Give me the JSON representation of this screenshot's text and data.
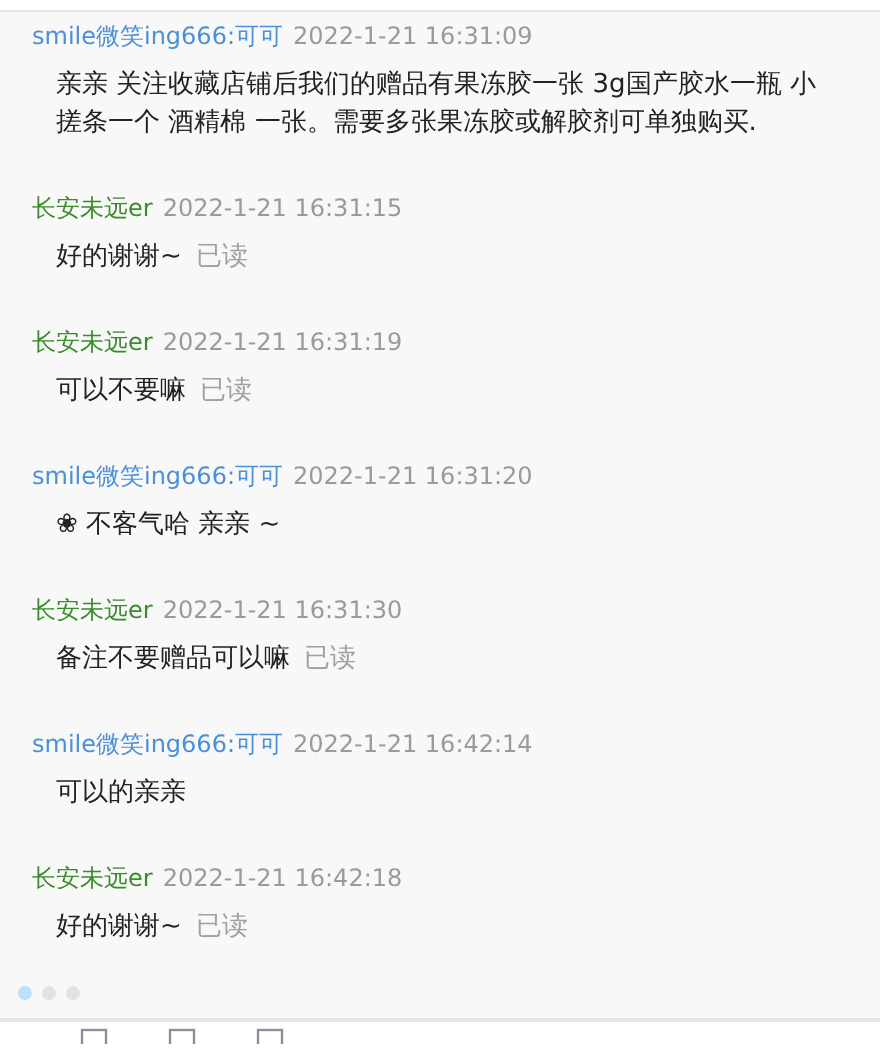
{
  "messages": [
    {
      "sender": "smile微笑ing666:可可",
      "kind": "shop",
      "time": "2022-1-21 16:31:09",
      "text": "亲亲 关注收藏店铺后我们的赠品有果冻胶一张 3g国产胶水一瓶 小搓条一个 酒精棉 一张。需要多张果冻胶或解胶剂可单独购买."
    },
    {
      "sender": "长安未远er",
      "kind": "customer",
      "time": "2022-1-21 16:31:15",
      "text": "好的谢谢~",
      "status": "已读"
    },
    {
      "sender": "长安未远er",
      "kind": "customer",
      "time": "2022-1-21 16:31:19",
      "text": "可以不要嘛",
      "status": "已读"
    },
    {
      "sender": "smile微笑ing666:可可",
      "kind": "shop",
      "time": "2022-1-21 16:31:20",
      "text": "❀ 不客气哈 亲亲 ~"
    },
    {
      "sender": "长安未远er",
      "kind": "customer",
      "time": "2022-1-21 16:31:30",
      "text": "备注不要赠品可以嘛",
      "status": "已读"
    },
    {
      "sender": "smile微笑ing666:可可",
      "kind": "shop",
      "time": "2022-1-21 16:42:14",
      "text": "可以的亲亲"
    },
    {
      "sender": "长安未远er",
      "kind": "customer",
      "time": "2022-1-21 16:42:18",
      "text": "好的谢谢~",
      "status": "已读"
    }
  ],
  "pager": [
    {
      "selected": true
    },
    {
      "selected": false
    },
    {
      "selected": false
    }
  ]
}
